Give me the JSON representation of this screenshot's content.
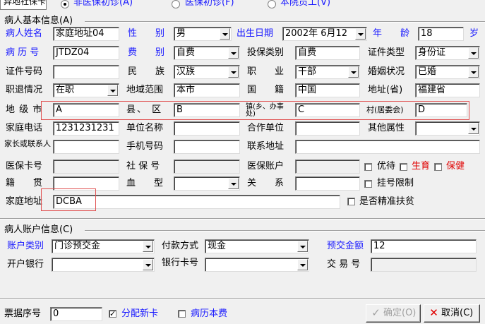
{
  "top_tabs": {
    "tab1": "异地社保卡",
    "radio1": "非医保初诊(A)",
    "radio2": "医保初诊(F)",
    "radio3": "本院员工(V)"
  },
  "patient_section": {
    "title": "病人基本信息(A)",
    "name_label": "病人姓名",
    "name_value": "家庭地址04",
    "sex_label": "性　　别",
    "sex_value": "男",
    "birth_label": "出生日期",
    "birth_value": "2002年 6月12",
    "age_label": "年　　龄",
    "age_value": "18",
    "age_unit": "岁",
    "record_label": "病 历 号",
    "record_value": "JTDZ04",
    "fee_label": "费　　别",
    "fee_value": "自费",
    "ins_type_label": "投保类别",
    "ins_type_value": "自费",
    "id_type_label": "证件类型",
    "id_type_value": "身份证",
    "id_no_label": "证件号码",
    "id_no_value": "",
    "nation_label": "民　　族",
    "nation_value": "汉族",
    "job_label": "职　　业",
    "job_value": "干部",
    "marital_label": "婚姻状况",
    "marital_value": "已婚",
    "retire_label": "职退情况",
    "retire_value": "在职",
    "area_label": "地域范围",
    "area_value": "本市",
    "country_label": "国　　籍",
    "country_value": "中国",
    "province_label": "地址(省)",
    "province_value": "福建省",
    "city_label": "地 级 市",
    "city_value": "A",
    "county_label": "县、 区",
    "county_value": "B",
    "town_label": "镇(乡、办事处)",
    "town_value": "C",
    "village_label": "村(居委会)",
    "village_value": "D",
    "phone_label": "家庭电话",
    "phone_value": "1231231231",
    "company_label": "单位名称",
    "company_value": "",
    "coop_label": "合作单位",
    "coop_value": "",
    "other_label": "其他属性",
    "other_value": "",
    "guardian_label": "家长或联系人",
    "guardian_value": "",
    "mobile_label": "手机号码",
    "mobile_value": "",
    "contact_addr_label": "联系地址",
    "contact_addr_value": "",
    "card_label": "医保卡号",
    "card_value": "",
    "social_label": "社 保 号",
    "social_value": "",
    "account_label": "医保账户",
    "account_value": "",
    "priority_label": "优待",
    "fertility_label": "生育",
    "health_label": "保健",
    "origin_label": "籍　　贯",
    "origin_value": "",
    "blood_label": "血　　型",
    "blood_value": "",
    "relation_label": "关　　系",
    "relation_value": "",
    "reg_limit_label": "挂号限制",
    "address_label": "家庭地址",
    "address_value": "DCBA",
    "poverty_label": "是否精准扶贫"
  },
  "account_section": {
    "title": "病人账户信息(C)",
    "acc_type_label": "账户类别",
    "acc_type_value": "门诊预交金",
    "pay_label": "付款方式",
    "pay_value": "现金",
    "prepay_label": "预交金额",
    "prepay_value": "12",
    "bank_label": "开户银行",
    "bank_value": "",
    "bank_card_label": "银行卡号",
    "bank_card_value": "",
    "trade_label": "交 易 号",
    "trade_value": ""
  },
  "footer": {
    "receipt_label": "票据序号",
    "receipt_value": "0",
    "new_card_label": "分配新卡",
    "new_card_checked": true,
    "record_fee_label": "病历本费",
    "ok_label": "确定(O)",
    "cancel_label": "取消(C)"
  }
}
